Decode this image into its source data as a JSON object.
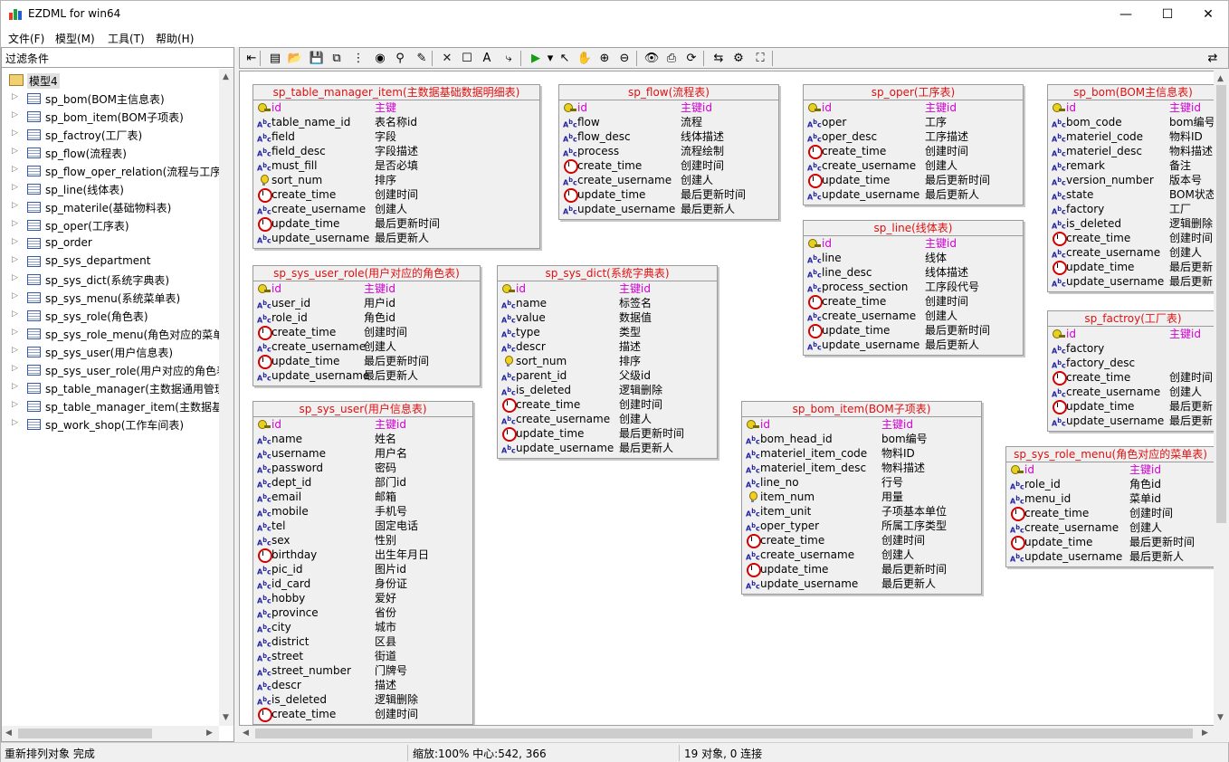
{
  "window": {
    "title": "EZDML for win64",
    "minimize": "—",
    "maximize": "☐",
    "close": "✕"
  },
  "menu": [
    "文件(F)",
    "模型(M)",
    "工具(T)",
    "帮助(H)"
  ],
  "filter_label": "过滤条件",
  "tree": {
    "root": "模型4",
    "items": [
      "sp_bom(BOM主信息表)",
      "sp_bom_item(BOM子项表)",
      "sp_factroy(工厂表)",
      "sp_flow(流程表)",
      "sp_flow_oper_relation(流程与工序",
      "sp_line(线体表)",
      "sp_materile(基础物料表)",
      "sp_oper(工序表)",
      "sp_order",
      "sp_sys_department",
      "sp_sys_dict(系统字典表)",
      "sp_sys_menu(系统菜单表)",
      "sp_sys_role(角色表)",
      "sp_sys_role_menu(角色对应的菜单",
      "sp_sys_user(用户信息表)",
      "sp_sys_user_role(用户对应的角色表",
      "sp_table_manager(主数据通用管理",
      "sp_table_manager_item(主数据基础",
      "sp_work_shop(工作车间表)"
    ]
  },
  "toolbar_icons": [
    "back-icon",
    "new-icon",
    "open-icon",
    "save-icon",
    "copy-icon",
    "tree-icon",
    "globe-icon",
    "binoculars-icon",
    "pen-icon",
    "delete-icon",
    "table-icon",
    "text-icon",
    "link-icon",
    "run-icon",
    "dropdown-icon",
    "pointer-icon",
    "hand-icon",
    "zoom-in-icon",
    "zoom-out-icon",
    "eye-icon",
    "print-icon",
    "refresh-icon",
    "layout-icon",
    "properties-icon",
    "fit-icon",
    "panel-toggle-icon"
  ],
  "entities": [
    {
      "title": "sp_table_manager_item(主数据基础数据明细表)",
      "fields": [
        [
          "key",
          "id",
          "主键"
        ],
        [
          "abc",
          "table_name_id",
          "表名称id"
        ],
        [
          "abc",
          "field",
          "字段"
        ],
        [
          "abc",
          "field_desc",
          "字段描述"
        ],
        [
          "abc",
          "must_fill",
          "是否必填"
        ],
        [
          "bulb",
          "sort_num",
          "排序"
        ],
        [
          "clk",
          "create_time",
          "创建时间"
        ],
        [
          "abc",
          "create_username",
          "创建人"
        ],
        [
          "clk",
          "update_time",
          "最后更新时间"
        ],
        [
          "abc",
          "update_username",
          "最后更新人"
        ]
      ]
    },
    {
      "title": "sp_flow(流程表)",
      "fields": [
        [
          "key",
          "id",
          "主键id"
        ],
        [
          "abc",
          "flow",
          "流程"
        ],
        [
          "abc",
          "flow_desc",
          "线体描述"
        ],
        [
          "abc",
          "process",
          "流程绘制"
        ],
        [
          "clk",
          "create_time",
          "创建时间"
        ],
        [
          "abc",
          "create_username",
          "创建人"
        ],
        [
          "clk",
          "update_time",
          "最后更新时间"
        ],
        [
          "abc",
          "update_username",
          "最后更新人"
        ]
      ]
    },
    {
      "title": "sp_oper(工序表)",
      "fields": [
        [
          "key",
          "id",
          "主键id"
        ],
        [
          "abc",
          "oper",
          "工序"
        ],
        [
          "abc",
          "oper_desc",
          "工序描述"
        ],
        [
          "clk",
          "create_time",
          "创建时间"
        ],
        [
          "abc",
          "create_username",
          "创建人"
        ],
        [
          "clk",
          "update_time",
          "最后更新时间"
        ],
        [
          "abc",
          "update_username",
          "最后更新人"
        ]
      ]
    },
    {
      "title": "sp_bom(BOM主信息表)",
      "fields": [
        [
          "key",
          "id",
          "主键id"
        ],
        [
          "abc",
          "bom_code",
          "bom编号"
        ],
        [
          "abc",
          "materiel_code",
          "物料ID"
        ],
        [
          "abc",
          "materiel_desc",
          "物料描述"
        ],
        [
          "abc",
          "remark",
          "备注"
        ],
        [
          "abc",
          "version_number",
          "版本号"
        ],
        [
          "abc",
          "state",
          "BOM状态"
        ],
        [
          "abc",
          "factory",
          "工厂"
        ],
        [
          "abc",
          "is_deleted",
          "逻辑删除"
        ],
        [
          "clk",
          "create_time",
          "创建时间"
        ],
        [
          "abc",
          "create_username",
          "创建人"
        ],
        [
          "clk",
          "update_time",
          "最后更新"
        ],
        [
          "abc",
          "update_username",
          "最后更新"
        ]
      ]
    },
    {
      "title": "sp_line(线体表)",
      "fields": [
        [
          "key",
          "id",
          "主键id"
        ],
        [
          "abc",
          "line",
          "线体"
        ],
        [
          "abc",
          "line_desc",
          "线体描述"
        ],
        [
          "abc",
          "process_section",
          "工序段代号"
        ],
        [
          "clk",
          "create_time",
          "创建时间"
        ],
        [
          "abc",
          "create_username",
          "创建人"
        ],
        [
          "clk",
          "update_time",
          "最后更新时间"
        ],
        [
          "abc",
          "update_username",
          "最后更新人"
        ]
      ]
    },
    {
      "title": "sp_sys_user_role(用户对应的角色表)",
      "fields": [
        [
          "key",
          "id",
          "主键id"
        ],
        [
          "abc",
          "user_id",
          "用户id"
        ],
        [
          "abc",
          "role_id",
          "角色id"
        ],
        [
          "clk",
          "create_time",
          "创建时间"
        ],
        [
          "abc",
          "create_username",
          "创建人"
        ],
        [
          "clk",
          "update_time",
          "最后更新时间"
        ],
        [
          "abc",
          "update_username",
          "最后更新人"
        ]
      ]
    },
    {
      "title": "sp_sys_dict(系统字典表)",
      "fields": [
        [
          "key",
          "id",
          "主键id"
        ],
        [
          "abc",
          "name",
          "标签名"
        ],
        [
          "abc",
          "value",
          "数据值"
        ],
        [
          "abc",
          "type",
          "类型"
        ],
        [
          "abc",
          "descr",
          "描述"
        ],
        [
          "bulb",
          "sort_num",
          "排序"
        ],
        [
          "abc",
          "parent_id",
          "父级id"
        ],
        [
          "abc",
          "is_deleted",
          "逻辑删除"
        ],
        [
          "clk",
          "create_time",
          "创建时间"
        ],
        [
          "abc",
          "create_username",
          "创建人"
        ],
        [
          "clk",
          "update_time",
          "最后更新时间"
        ],
        [
          "abc",
          "update_username",
          "最后更新人"
        ]
      ]
    },
    {
      "title": "sp_factroy(工厂表)",
      "fields": [
        [
          "key",
          "id",
          "主键id"
        ],
        [
          "abc",
          "factory",
          ""
        ],
        [
          "abc",
          "factory_desc",
          ""
        ],
        [
          "clk",
          "create_time",
          "创建时间"
        ],
        [
          "abc",
          "create_username",
          "创建人"
        ],
        [
          "clk",
          "update_time",
          "最后更新"
        ],
        [
          "abc",
          "update_username",
          "最后更新"
        ]
      ]
    },
    {
      "title": "sp_sys_user(用户信息表)",
      "fields": [
        [
          "key",
          "id",
          "主键id"
        ],
        [
          "abc",
          "name",
          "姓名"
        ],
        [
          "abc",
          "username",
          "用户名"
        ],
        [
          "abc",
          "password",
          "密码"
        ],
        [
          "abc",
          "dept_id",
          "部门id"
        ],
        [
          "abc",
          "email",
          "邮箱"
        ],
        [
          "abc",
          "mobile",
          "手机号"
        ],
        [
          "abc",
          "tel",
          "固定电话"
        ],
        [
          "abc",
          "sex",
          "性别"
        ],
        [
          "clk",
          "birthday",
          "出生年月日"
        ],
        [
          "abc",
          "pic_id",
          "图片id"
        ],
        [
          "abc",
          "id_card",
          "身份证"
        ],
        [
          "abc",
          "hobby",
          "爱好"
        ],
        [
          "abc",
          "province",
          "省份"
        ],
        [
          "abc",
          "city",
          "城市"
        ],
        [
          "abc",
          "district",
          "区县"
        ],
        [
          "abc",
          "street",
          "街道"
        ],
        [
          "abc",
          "street_number",
          "门牌号"
        ],
        [
          "abc",
          "descr",
          "描述"
        ],
        [
          "abc",
          "is_deleted",
          "逻辑删除"
        ],
        [
          "clk",
          "create_time",
          "创建时间"
        ]
      ]
    },
    {
      "title": "sp_bom_item(BOM子项表)",
      "fields": [
        [
          "key",
          "id",
          "主键id"
        ],
        [
          "abc",
          "bom_head_id",
          "bom编号"
        ],
        [
          "abc",
          "materiel_item_code",
          "物料ID"
        ],
        [
          "abc",
          "materiel_item_desc",
          "物料描述"
        ],
        [
          "abc",
          "line_no",
          "行号"
        ],
        [
          "bulb",
          "item_num",
          "用量"
        ],
        [
          "abc",
          "item_unit",
          "子项基本单位"
        ],
        [
          "abc",
          "oper_typer",
          "所属工序类型"
        ],
        [
          "clk",
          "create_time",
          "创建时间"
        ],
        [
          "abc",
          "create_username",
          "创建人"
        ],
        [
          "clk",
          "update_time",
          "最后更新时间"
        ],
        [
          "abc",
          "update_username",
          "最后更新人"
        ]
      ]
    },
    {
      "title": "sp_sys_role_menu(角色对应的菜单表)",
      "fields": [
        [
          "key",
          "id",
          "主键id"
        ],
        [
          "abc",
          "role_id",
          "角色id"
        ],
        [
          "abc",
          "menu_id",
          "菜单id"
        ],
        [
          "clk",
          "create_time",
          "创建时间"
        ],
        [
          "abc",
          "create_username",
          "创建人"
        ],
        [
          "clk",
          "update_time",
          "最后更新时间"
        ],
        [
          "abc",
          "update_username",
          "最后更新人"
        ]
      ]
    }
  ],
  "status": {
    "left": "重新排列对象 完成",
    "middle": "缩放:100% 中心:542, 366",
    "right": "19 对象, 0 连接"
  }
}
